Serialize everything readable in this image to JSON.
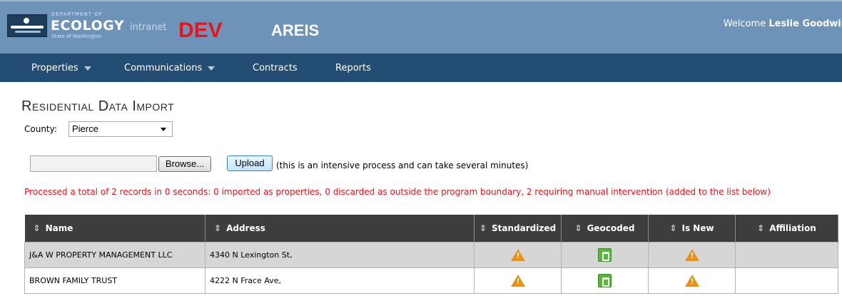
{
  "header": {
    "logo_department": "DEPARTMENT OF",
    "logo_ecology": "ECOLOGY",
    "logo_intranet": "intranet",
    "logo_state": "State of Washington",
    "environment": "DEV",
    "app_name": "AREIS",
    "welcome_prefix": "Welcome",
    "user_name": "Leslie Goodwin"
  },
  "nav": {
    "items": [
      {
        "label": "Properties"
      },
      {
        "label": "Communications"
      },
      {
        "label": "Contracts"
      },
      {
        "label": "Reports"
      }
    ]
  },
  "page": {
    "title": "Residential Data Import",
    "county_label": "County:",
    "county_value": "Pierce",
    "file_value": "",
    "browse_label": "Browse...",
    "upload_label": "Upload",
    "upload_note": "(this is an intensive process and can take several minutes)",
    "message": "Processed a total of 2 records in 0 seconds: 0 imported as properties, 0 discarded as outside the program boundary, 2 requiring manual intervention (added to the list below)"
  },
  "table": {
    "sort_glyph": "⇕",
    "columns": [
      "Name",
      "Address",
      "Standardized",
      "Geocoded",
      "Is New",
      "Affiliation"
    ],
    "rows": [
      {
        "name": "J&A W PROPERTY MANAGEMENT LLC",
        "address": "4340 N Lexington St,",
        "standardized": "warning-icon",
        "geocoded": "thumbs-up-icon",
        "is_new": "warning-icon",
        "affiliation": ""
      },
      {
        "name": "BROWN FAMILY TRUST",
        "address": "4222 N Frace Ave,",
        "standardized": "warning-icon",
        "geocoded": "thumbs-up-icon",
        "is_new": "warning-icon",
        "affiliation": ""
      }
    ]
  },
  "colors": {
    "header_bg": "#6e93b9",
    "nav_bg": "#234d73",
    "env_red": "#e8141c",
    "table_header_bg": "#3d3d3d",
    "warning_orange": "#f0910e",
    "ok_green": "#59b63a"
  }
}
